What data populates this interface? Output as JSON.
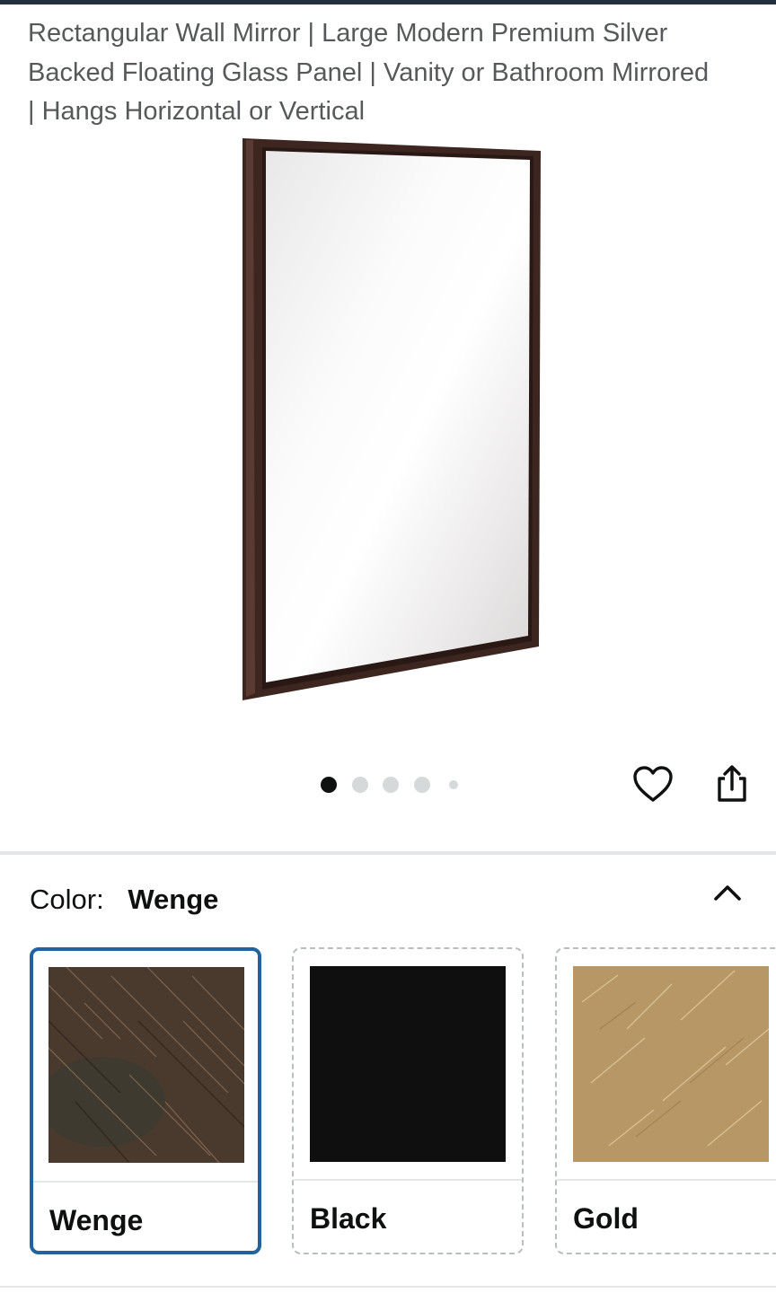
{
  "product": {
    "title_lines": [
      "Rectangular Wall Mirror | Large Modern Premium Silver",
      "Backed Floating Glass Panel | Vanity or Bathroom Mirrored",
      "| Hangs Horizontal or Vertical"
    ]
  },
  "gallery": {
    "image_count": 5,
    "active_index": 0,
    "wishlist_icon": "heart-outline-icon",
    "share_icon": "share-icon"
  },
  "color_selector": {
    "label": "Color:",
    "selected_value": "Wenge",
    "toggle_icon": "chevron-up-icon",
    "options": [
      {
        "name": "Wenge",
        "selected": true,
        "swatch_color": "#4a3a2e"
      },
      {
        "name": "Black",
        "selected": false,
        "swatch_color": "#0f0f0f"
      },
      {
        "name": "Gold",
        "selected": false,
        "swatch_color": "#b89766"
      }
    ]
  },
  "colors": {
    "selected_border": "#2162a1",
    "frame": "#3d2620",
    "text_secondary": "#565959"
  }
}
